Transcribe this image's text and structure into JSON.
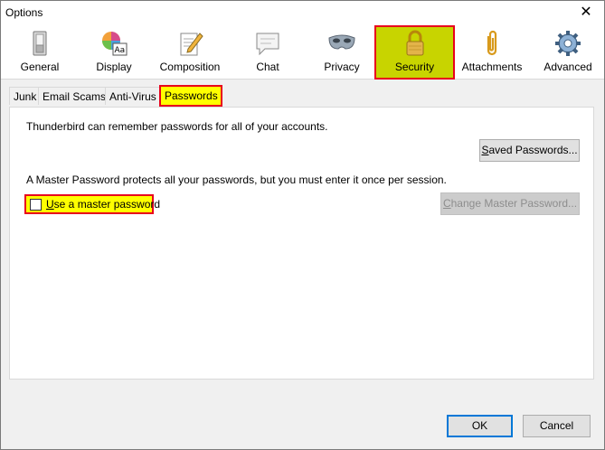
{
  "window": {
    "title": "Options",
    "close": "✕"
  },
  "toolbar": {
    "panes": [
      {
        "label": "General"
      },
      {
        "label": "Display"
      },
      {
        "label": "Composition"
      },
      {
        "label": "Chat"
      },
      {
        "label": "Privacy"
      },
      {
        "label": "Security",
        "selected": true
      },
      {
        "label": "Attachments"
      },
      {
        "label": "Advanced"
      }
    ]
  },
  "subtabs": [
    {
      "label": "Junk"
    },
    {
      "label": "Email Scams"
    },
    {
      "label": "Anti-Virus"
    },
    {
      "label": "Passwords",
      "active": true
    }
  ],
  "panel": {
    "remember_text": "Thunderbird can remember passwords for all of your accounts.",
    "saved_passwords_button": {
      "accesskey": "S",
      "rest": "aved Passwords..."
    },
    "master_text": "A Master Password protects all your passwords, but you must enter it once per session.",
    "use_master_checkbox": {
      "accesskey": "U",
      "rest": "se a master password",
      "checked": false
    },
    "change_master_button": {
      "accesskey": "C",
      "rest": "hange Master Password...",
      "enabled": false
    }
  },
  "footer": {
    "ok_label": "OK",
    "cancel_label": "Cancel"
  },
  "colors": {
    "highlight": "#ffff00",
    "outline": "#e8001c",
    "selected_pane": "#c8d400",
    "default_button": "#0078d7"
  }
}
